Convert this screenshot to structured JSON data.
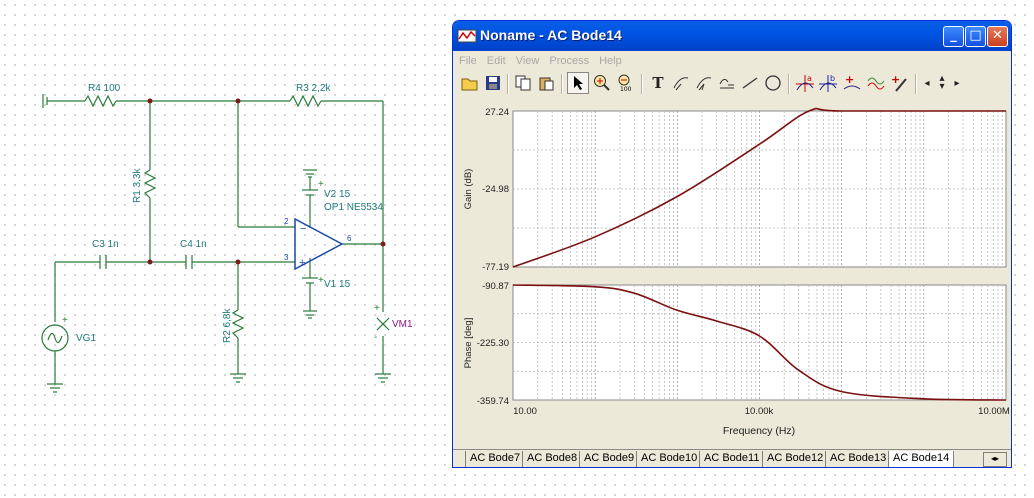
{
  "schematic": {
    "labels": {
      "r4": "R4 100",
      "r3": "R3 2,2k",
      "r1": "R1 3,3k",
      "c3": "C3 1n",
      "c4": "C4 1n",
      "r2": "R2 6,8k",
      "v2": "V2 15",
      "op1": "OP1 NE5534",
      "v1": "V1 15",
      "vg1": "VG1",
      "vm1": "VM1",
      "pin2": "2",
      "pin3": "3",
      "pin6": "6"
    }
  },
  "window": {
    "title": "Noname - AC Bode14",
    "menu": [
      "File",
      "Edit",
      "View",
      "Process",
      "Help"
    ],
    "toolbar_icons": [
      "open-icon",
      "save-icon",
      "copy-icon",
      "paste-icon",
      "pointer-icon",
      "zoom-in-icon",
      "zoom-100-icon",
      "text-icon",
      "curve-label-icon",
      "curve-label2-icon",
      "formula-icon",
      "line-icon",
      "circle-icon",
      "cursor-a-icon",
      "cursor-b-icon",
      "add-curve-icon",
      "wave-icon",
      "pen-icon",
      "scroll-left-icon",
      "scroll-updown-icon",
      "scroll-right-icon"
    ]
  },
  "chart_data": [
    {
      "type": "line",
      "ylabel": "Gain (dB)",
      "yticks": [
        "27.24",
        "-24.98",
        "-77.19"
      ],
      "ylim": [
        -77.19,
        27.24
      ],
      "xscale": "log",
      "xlim": [
        10,
        10000000
      ],
      "grid": true,
      "series": [
        {
          "color": "#7a1010",
          "x": [
            10,
            100,
            1000,
            10000,
            40000,
            100000,
            10000000
          ],
          "y": [
            -77.19,
            -57,
            -30,
            5,
            27.24,
            27.24,
            27.24
          ]
        }
      ]
    },
    {
      "type": "line",
      "ylabel": "Phase [deg]",
      "yticks": [
        "-90.87",
        "-225.30",
        "-359.74"
      ],
      "ylim": [
        -359.74,
        -90.87
      ],
      "xscale": "log",
      "xlim": [
        10,
        10000000
      ],
      "xlabel": "Frequency (Hz)",
      "xticks": [
        "10.00",
        "10.00k",
        "10.00M"
      ],
      "grid": true,
      "series": [
        {
          "color": "#7a1010",
          "x": [
            10,
            100,
            300,
            1000,
            3000,
            10000,
            30000,
            100000,
            1000000,
            10000000
          ],
          "y": [
            -90.87,
            -95,
            -110,
            -150,
            -175,
            -210,
            -290,
            -340,
            -357,
            -359.74
          ]
        }
      ]
    }
  ],
  "tabs": [
    "AC Bode7",
    "AC Bode8",
    "AC Bode9",
    "AC Bode10",
    "AC Bode11",
    "AC Bode12",
    "AC Bode13",
    "AC Bode14"
  ],
  "active_tab": "AC Bode14"
}
